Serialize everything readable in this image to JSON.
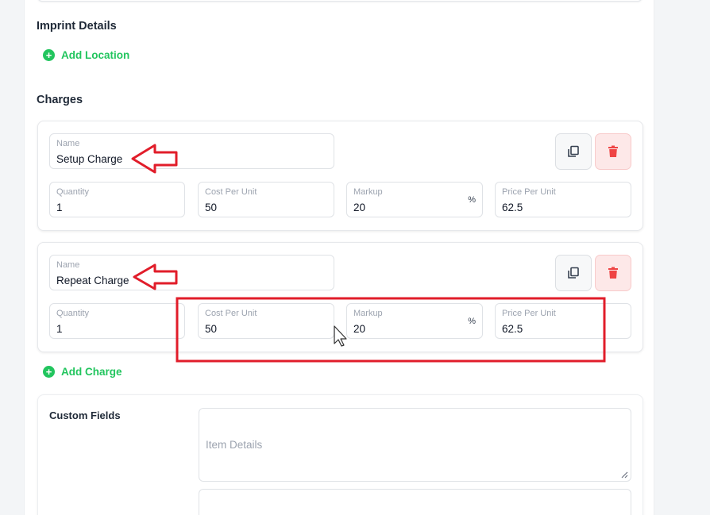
{
  "imprint": {
    "title": "Imprint Details",
    "add_location_label": "Add Location"
  },
  "charges": {
    "title": "Charges",
    "items": [
      {
        "name_label": "Name",
        "name": "Setup Charge",
        "quantity_label": "Quantity",
        "quantity": "1",
        "cost_label": "Cost Per Unit",
        "cost": "50",
        "markup_label": "Markup",
        "markup": "20",
        "markup_unit": "%",
        "price_label": "Price Per Unit",
        "price": "62.5"
      },
      {
        "name_label": "Name",
        "name": "Repeat Charge",
        "quantity_label": "Quantity",
        "quantity": "1",
        "cost_label": "Cost Per Unit",
        "cost": "50",
        "markup_label": "Markup",
        "markup": "20",
        "markup_unit": "%",
        "price_label": "Price Per Unit",
        "price": "62.5"
      }
    ],
    "add_charge_label": "Add Charge",
    "copy_icon": "copy-icon",
    "delete_icon": "trash-icon"
  },
  "custom_fields": {
    "title": "Custom Fields",
    "item_details_placeholder": "Item Details"
  },
  "colors": {
    "accent_green": "#22c55e",
    "danger_red": "#ef4444",
    "annotation_red": "#e11d2a"
  }
}
